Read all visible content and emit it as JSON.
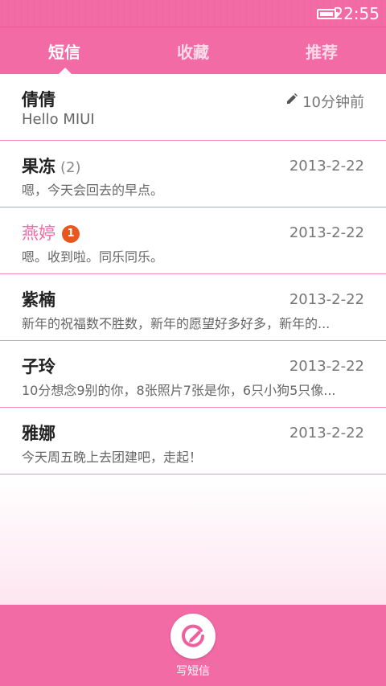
{
  "status_bar": {
    "time": "22:55",
    "battery_icon": "battery-icon"
  },
  "tabs": [
    {
      "label": "短信",
      "active": true
    },
    {
      "label": "收藏",
      "active": false
    },
    {
      "label": "推荐",
      "active": false
    }
  ],
  "conversations": [
    {
      "name": "倩倩",
      "preview": "Hello MIUI",
      "time": "10分钟前",
      "icon": "pencil-icon"
    },
    {
      "name": "果冻",
      "count": "(2)",
      "preview": "嗯，今天会回去的早点。",
      "time": "2013-2-22"
    },
    {
      "name": "燕婷",
      "badge": "1",
      "preview": "嗯。收到啦。同乐同乐。",
      "time": "2013-2-22"
    },
    {
      "name": "紫楠",
      "preview": "新年的祝福数不胜数，新年的愿望好多好多，新年的...",
      "time": "2013-2-22"
    },
    {
      "name": "子玲",
      "preview": "10分想念9别的你，8张照片7张是你，6只小狗5只像...",
      "time": "2013-2-22"
    },
    {
      "name": "雅娜",
      "preview": "今天周五晚上去团建吧，走起！",
      "time": "2013-2-22"
    }
  ],
  "bottom_bar": {
    "compose_label": "写短信",
    "compose_icon": "compose-icon"
  },
  "colors": {
    "accent": "#f16aa6",
    "badge": "#e9571f"
  }
}
